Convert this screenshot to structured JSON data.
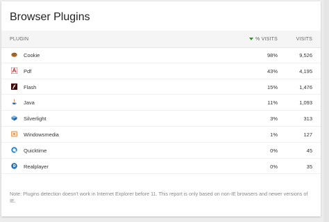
{
  "title": "Browser Plugins",
  "headers": {
    "plugin": "PLUGIN",
    "pct_visits": "% VISITS",
    "visits": "VISITS"
  },
  "rows": [
    {
      "name": "Cookie",
      "pct": "98%",
      "visits": "9,526",
      "icon": "cookie-icon"
    },
    {
      "name": "Pdf",
      "pct": "43%",
      "visits": "4,195",
      "icon": "pdf-icon"
    },
    {
      "name": "Flash",
      "pct": "15%",
      "visits": "1,476",
      "icon": "flash-icon"
    },
    {
      "name": "Java",
      "pct": "11%",
      "visits": "1,093",
      "icon": "java-icon"
    },
    {
      "name": "Silverlight",
      "pct": "3%",
      "visits": "313",
      "icon": "silverlight-icon"
    },
    {
      "name": "Windowsmedia",
      "pct": "1%",
      "visits": "127",
      "icon": "windowsmedia-icon"
    },
    {
      "name": "Quicktime",
      "pct": "0%",
      "visits": "45",
      "icon": "quicktime-icon"
    },
    {
      "name": "Realplayer",
      "pct": "0%",
      "visits": "35",
      "icon": "realplayer-icon"
    }
  ],
  "note": "Note: Plugins detection doesn't work in Internet Explorer before 11. This report is only based on non-IE browsers and newer versions of IE.",
  "colors": {
    "accent_sort": "#3a8a3a",
    "background": "#ececec",
    "card": "#ffffff",
    "header_row": "#f5f5f5"
  }
}
